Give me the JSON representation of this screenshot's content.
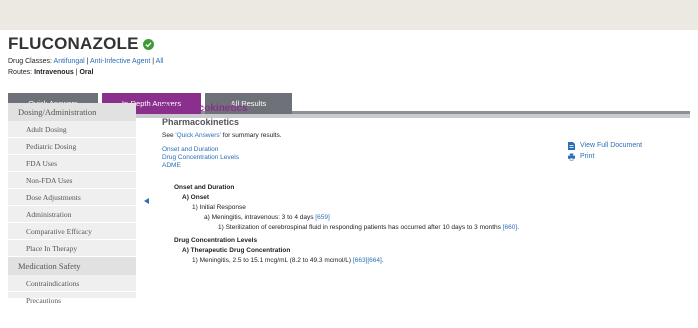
{
  "drug": {
    "name": "FLUCONAZOLE",
    "classes_label": "Drug Classes:",
    "classes": [
      "Antifungal",
      "Anti-Infective Agent",
      "All"
    ],
    "routes_label": "Routes:",
    "routes": [
      "Intravenous",
      "Oral"
    ]
  },
  "tabs": [
    "Quick Answers",
    "In-Depth Answers",
    "All Results"
  ],
  "active_tab": "In-Depth Answers",
  "sidebar": {
    "section1": "Dosing/Administration",
    "items1": [
      "Adult Dosing",
      "Pediatric Dosing",
      "FDA Uses",
      "Non-FDA Uses",
      "Dose Adjustments",
      "Administration",
      "Comparative Efficacy",
      "Place In Therapy"
    ],
    "section2": "Medication Safety",
    "items2": [
      "Contraindications",
      "Precautions"
    ]
  },
  "content": {
    "title": "Pharmacokinetics",
    "subtitle": "Pharmacokinetics",
    "see_prefix": "See ",
    "see_link": "'Quick Answers'",
    "see_suffix": " for summary results.",
    "links": [
      "Onset and Duration",
      "Drug Concentration Levels",
      "ADME"
    ],
    "onset": {
      "heading": "Onset and Duration",
      "a": "A) Onset",
      "a1": "1) Initial Response",
      "a1a": "a) Meningitis, intravenous: 3 to 4 days",
      "a1a_ref": "[659]",
      "a1a1": "1) Sterilization of cerebrospinal fluid in responding patients has occurred after 10 days to 3 months",
      "a1a1_ref": "[660]"
    },
    "levels": {
      "heading": "Drug Concentration Levels",
      "a": "A) Therapeutic Drug Concentration",
      "a1": "1) Meningitis, 2.5 to 15.1 mcg/mL (8.2 to 49.3 mcmol/L)",
      "a1_ref": "[663][664]",
      "a1_end": "."
    }
  },
  "actions": [
    "View Full Document",
    "Print"
  ],
  "colors": {
    "accent": "#8a2f8e",
    "link": "#2a6fb8",
    "tab": "#6e7177",
    "check": "#3f9b36"
  }
}
